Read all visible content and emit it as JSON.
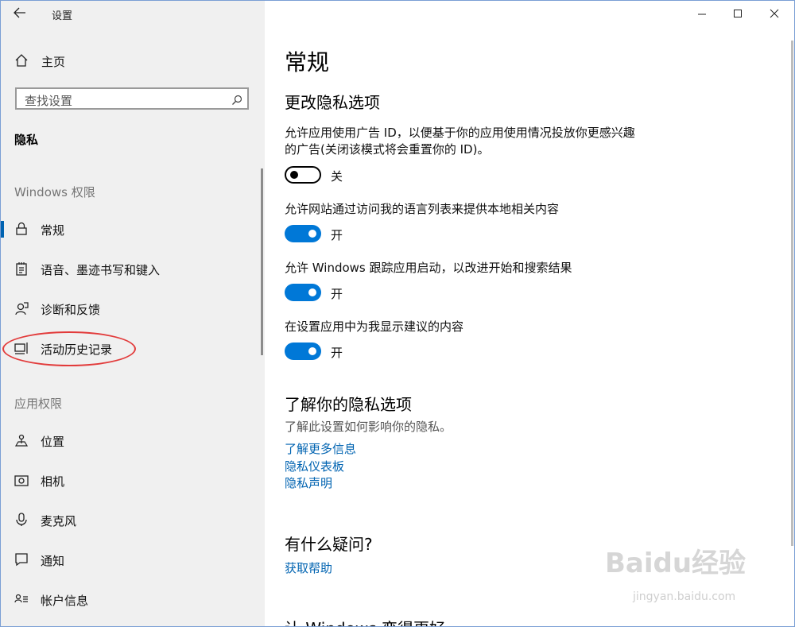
{
  "titlebar": {
    "title": "设置"
  },
  "sidebar": {
    "home_label": "主页",
    "search_placeholder": "查找设置",
    "current_category": "隐私",
    "windows_section": "Windows 权限",
    "windows_items": [
      {
        "label": "常规",
        "icon": "lock-icon"
      },
      {
        "label": "语音、墨迹书写和键入",
        "icon": "notebook-icon"
      },
      {
        "label": "诊断和反馈",
        "icon": "feedback-icon"
      },
      {
        "label": "活动历史记录",
        "icon": "timeline-icon"
      }
    ],
    "app_section": "应用权限",
    "app_items": [
      {
        "label": "位置",
        "icon": "location-icon"
      },
      {
        "label": "相机",
        "icon": "camera-icon"
      },
      {
        "label": "麦克风",
        "icon": "microphone-icon"
      },
      {
        "label": "通知",
        "icon": "notification-icon"
      },
      {
        "label": "帐户信息",
        "icon": "account-info-icon"
      }
    ]
  },
  "main": {
    "page_title": "常规",
    "section_title": "更改隐私选项",
    "settings": [
      {
        "desc_line1": "允许应用使用广告 ID，以便基于你的应用使用情况投放你更感兴趣",
        "desc_line2": "的广告(关闭该模式将会重置你的 ID)。",
        "state": "关",
        "on": false
      },
      {
        "desc_line1": "允许网站通过访问我的语言列表来提供本地相关内容",
        "state": "开",
        "on": true
      },
      {
        "desc_line1": "允许 Windows 跟踪应用启动，以改进开始和搜索结果",
        "state": "开",
        "on": true
      },
      {
        "desc_line1": "在设置应用中为我显示建议的内容",
        "state": "开",
        "on": true
      }
    ],
    "learn_title": "了解你的隐私选项",
    "learn_desc": "了解此设置如何影响你的隐私。",
    "links": [
      "了解更多信息",
      "隐私仪表板",
      "隐私声明"
    ],
    "question_title": "有什么疑问?",
    "help_link": "获取帮助",
    "bottom_title": "让 Windows 变得更好"
  },
  "watermark": {
    "logo": "Baidu经验",
    "site": "jingyan.baidu.com"
  },
  "colors": {
    "accent": "#0078d7",
    "link": "#0063b1",
    "highlight": "#e23b3b"
  }
}
